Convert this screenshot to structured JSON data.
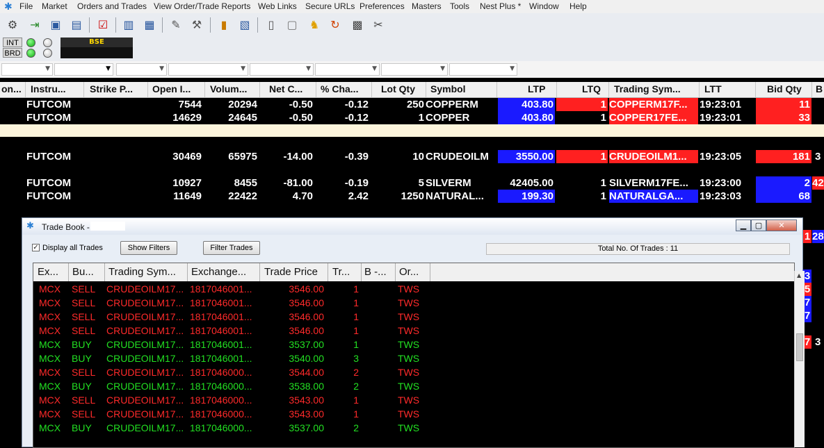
{
  "menu": {
    "items": [
      "File",
      "Market",
      "Orders and Trades",
      "View Order/Trade Reports",
      "Web Links",
      "Secure URLs",
      "Preferences",
      "Masters",
      "Tools",
      "Nest Plus *",
      "Window",
      "Help"
    ]
  },
  "exchange": {
    "int_label": "INT",
    "brd_label": "BRD",
    "panel_label": "BSE"
  },
  "market_watch": {
    "headers": [
      "on...",
      "Instru...",
      "Strike P...",
      "Open I...",
      "Volum...",
      "Net C...",
      "% Cha...",
      "Lot Qty",
      "Symbol",
      "LTP",
      "LTQ",
      "Trading Sym...",
      "LTT",
      "Bid Qty",
      "B"
    ],
    "rows": [
      {
        "instrument": "FUTCOM",
        "open_interest": "7544",
        "volume": "20294",
        "net_change": "-0.50",
        "pct_change": "-0.12",
        "lot_qty": "250",
        "symbol": "COPPERM",
        "ltp": "403.80",
        "ltq": "1",
        "trading_symbol": "COPPERM17F...",
        "ltt": "19:23:01",
        "bid_qty": "11",
        "extra": ""
      },
      {
        "instrument": "FUTCOM",
        "open_interest": "14629",
        "volume": "24645",
        "net_change": "-0.50",
        "pct_change": "-0.12",
        "lot_qty": "1",
        "symbol": "COPPER",
        "ltp": "403.80",
        "ltq": "1",
        "trading_symbol": "COPPER17FE...",
        "ltt": "19:23:01",
        "bid_qty": "33",
        "extra": ""
      },
      {
        "instrument": "FUTCOM",
        "open_interest": "30469",
        "volume": "65975",
        "net_change": "-14.00",
        "pct_change": "-0.39",
        "lot_qty": "10",
        "symbol": "CRUDEOILM",
        "ltp": "3550.00",
        "ltq": "1",
        "trading_symbol": "CRUDEOILM1...",
        "ltt": "19:23:05",
        "bid_qty": "181",
        "extra": "3"
      },
      {
        "instrument": "FUTCOM",
        "open_interest": "10927",
        "volume": "8455",
        "net_change": "-81.00",
        "pct_change": "-0.19",
        "lot_qty": "5",
        "symbol": "SILVERM",
        "ltp": "42405.00",
        "ltq": "1",
        "trading_symbol": "SILVERM17FE...",
        "ltt": "19:23:00",
        "bid_qty": "2",
        "extra": "42"
      },
      {
        "instrument": "FUTCOM",
        "open_interest": "11649",
        "volume": "22422",
        "net_change": "4.70",
        "pct_change": "2.42",
        "lot_qty": "1250",
        "symbol": "NATURAL...",
        "ltp": "199.30",
        "ltq": "1",
        "trading_symbol": "NATURALGA...",
        "ltt": "19:23:03",
        "bid_qty": "68",
        "extra": ""
      }
    ],
    "right_edge_values": [
      "1",
      "28",
      "3",
      "5",
      "7",
      "7",
      "7",
      "3"
    ]
  },
  "trade_book": {
    "title": "Trade Book -",
    "display_all_label": "Display all Trades",
    "show_filters_label": "Show Filters",
    "filter_trades_label": "Filter Trades",
    "total_label": "Total No. Of Trades : 11",
    "headers": [
      "Ex...",
      "Bu...",
      "Trading Sym...",
      "Exchange...",
      "Trade Price",
      "Tr...",
      "B -...",
      "Or..."
    ],
    "rows": [
      {
        "side_class": "sell",
        "exchange": "MCX",
        "buy_sell": "SELL",
        "symbol": "CRUDEOILM17...",
        "exch_id": "1817046001...",
        "price": "3546.00",
        "qty": "1",
        "origin": "TWS"
      },
      {
        "side_class": "sell",
        "exchange": "MCX",
        "buy_sell": "SELL",
        "symbol": "CRUDEOILM17...",
        "exch_id": "1817046001...",
        "price": "3546.00",
        "qty": "1",
        "origin": "TWS"
      },
      {
        "side_class": "sell",
        "exchange": "MCX",
        "buy_sell": "SELL",
        "symbol": "CRUDEOILM17...",
        "exch_id": "1817046001...",
        "price": "3546.00",
        "qty": "1",
        "origin": "TWS"
      },
      {
        "side_class": "sell",
        "exchange": "MCX",
        "buy_sell": "SELL",
        "symbol": "CRUDEOILM17...",
        "exch_id": "1817046001...",
        "price": "3546.00",
        "qty": "1",
        "origin": "TWS"
      },
      {
        "side_class": "buy",
        "exchange": "MCX",
        "buy_sell": "BUY",
        "symbol": "CRUDEOILM17...",
        "exch_id": "1817046001...",
        "price": "3537.00",
        "qty": "1",
        "origin": "TWS"
      },
      {
        "side_class": "buy",
        "exchange": "MCX",
        "buy_sell": "BUY",
        "symbol": "CRUDEOILM17...",
        "exch_id": "1817046001...",
        "price": "3540.00",
        "qty": "3",
        "origin": "TWS"
      },
      {
        "side_class": "sell",
        "exchange": "MCX",
        "buy_sell": "SELL",
        "symbol": "CRUDEOILM17...",
        "exch_id": "1817046000...",
        "price": "3544.00",
        "qty": "2",
        "origin": "TWS"
      },
      {
        "side_class": "buy",
        "exchange": "MCX",
        "buy_sell": "BUY",
        "symbol": "CRUDEOILM17...",
        "exch_id": "1817046000...",
        "price": "3538.00",
        "qty": "2",
        "origin": "TWS"
      },
      {
        "side_class": "sell",
        "exchange": "MCX",
        "buy_sell": "SELL",
        "symbol": "CRUDEOILM17...",
        "exch_id": "1817046000...",
        "price": "3543.00",
        "qty": "1",
        "origin": "TWS"
      },
      {
        "side_class": "sell",
        "exchange": "MCX",
        "buy_sell": "SELL",
        "symbol": "CRUDEOILM17...",
        "exch_id": "1817046000...",
        "price": "3543.00",
        "qty": "1",
        "origin": "TWS"
      },
      {
        "side_class": "buy",
        "exchange": "MCX",
        "buy_sell": "BUY",
        "symbol": "CRUDEOILM17...",
        "exch_id": "1817046000...",
        "price": "3537.00",
        "qty": "2",
        "origin": "TWS"
      }
    ]
  },
  "colors": {
    "buy": "#22e022",
    "sell": "#ff2a2a",
    "ltp_up": "#1a1aff",
    "ltp_down": "#ff2020",
    "separator": "#fdf5dc"
  }
}
